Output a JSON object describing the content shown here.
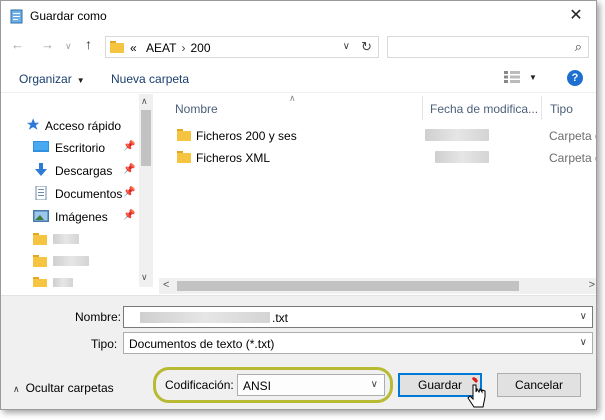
{
  "window": {
    "title": "Guardar como",
    "close": "✕"
  },
  "address": {
    "back": "←",
    "forward": "→",
    "recent": "∨",
    "up": "↑",
    "prefix": "«",
    "path": [
      "AEAT",
      "200"
    ],
    "separator": "›",
    "dropdown": "∨",
    "refresh": "↻",
    "search_placeholder": "",
    "search_icon": "⌕"
  },
  "toolbar": {
    "organizar": "Organizar",
    "nueva_carpeta": "Nueva carpeta",
    "caret": "▼",
    "help": "?"
  },
  "nav": {
    "quick_access": "Acceso rápido",
    "items": [
      {
        "label": "Escritorio",
        "pin": "📌"
      },
      {
        "label": "Descargas",
        "pin": "📌"
      },
      {
        "label": "Documentos",
        "pin": "📌"
      },
      {
        "label": "Imágenes",
        "pin": "📌"
      }
    ],
    "scroll_up": "∧",
    "scroll_down": "∨"
  },
  "columns": {
    "nombre": "Nombre",
    "fecha": "Fecha de modifica...",
    "tipo": "Tipo",
    "sort_indicator": "∧"
  },
  "files": [
    {
      "name": "Ficheros 200 y ses",
      "type": "Carpeta d"
    },
    {
      "name": "Ficheros XML",
      "type": "Carpeta d"
    }
  ],
  "hscroll": {
    "left": "<",
    "right": ">"
  },
  "form": {
    "nombre_label": "Nombre:",
    "nombre_ext": ".txt",
    "tipo_label": "Tipo:",
    "tipo_value": "Documentos de texto (*.txt)",
    "codificacion_label": "Codificación:",
    "codificacion_value": "ANSI",
    "caret": "∨"
  },
  "buttons": {
    "guardar": "Guardar",
    "cancelar": "Cancelar"
  },
  "ocultar": {
    "chevron": "∧",
    "label": "Ocultar carpetas"
  },
  "colors": {
    "accent": "#0078d7",
    "highlight_ring": "#b7ba32",
    "folder": "#f5c542",
    "link": "#1a3e6e"
  }
}
